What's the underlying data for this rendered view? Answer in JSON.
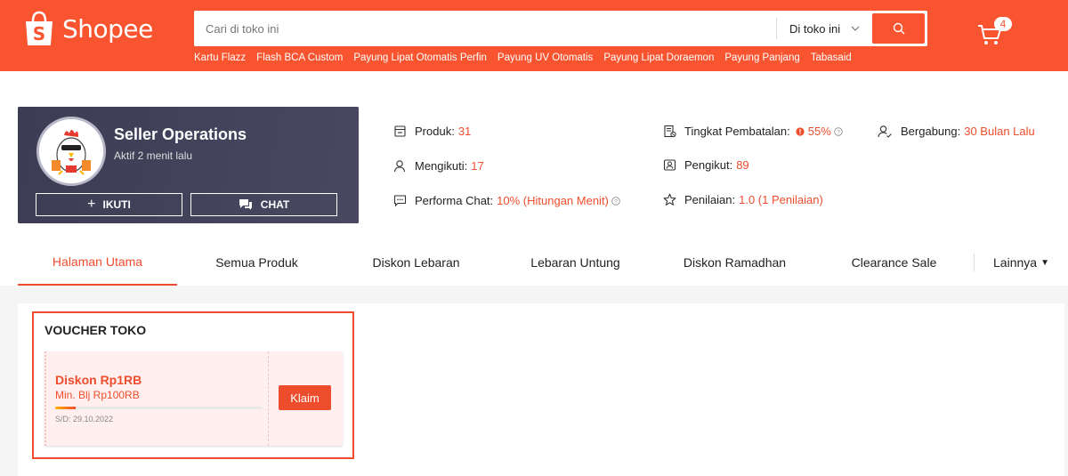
{
  "header": {
    "brand": "Shopee",
    "search_placeholder": "Cari di toko ini",
    "search_scope": "Di toko ini",
    "quick_links": [
      "Kartu Flazz",
      "Flash BCA Custom",
      "Payung Lipat Otomatis Perfin",
      "Payung UV Otomatis",
      "Payung Lipat Doraemon",
      "Payung Panjang",
      "Tabasaid"
    ],
    "cart_count": "4",
    "icons": {
      "search": "search-icon",
      "cart": "cart-icon",
      "scope_dropdown": "chevron-down-icon"
    }
  },
  "shop": {
    "name": "Seller Operations",
    "status": "Aktif 2 menit lalu",
    "follow_label": "IKUTI",
    "chat_label": "CHAT"
  },
  "stats": {
    "produk": {
      "label": "Produk:",
      "value": "31"
    },
    "mengikuti": {
      "label": "Mengikuti:",
      "value": "17"
    },
    "performa_chat": {
      "label": "Performa Chat:",
      "value": "10% (Hitungan Menit)"
    },
    "tingkat_pembatalan": {
      "label": "Tingkat Pembatalan:",
      "value": "55%"
    },
    "pengikut": {
      "label": "Pengikut:",
      "value": "89"
    },
    "penilaian": {
      "label": "Penilaian:",
      "value": "1.0 (1 Penilaian)"
    },
    "bergabung": {
      "label": "Bergabung:",
      "value": "30 Bulan Lalu"
    }
  },
  "tabs": [
    {
      "label": "Halaman Utama",
      "active": true
    },
    {
      "label": "Semua Produk",
      "active": false
    },
    {
      "label": "Diskon Lebaran",
      "active": false
    },
    {
      "label": "Lebaran Untung",
      "active": false
    },
    {
      "label": "Diskon Ramadhan",
      "active": false
    },
    {
      "label": "Clearance Sale",
      "active": false
    },
    {
      "label": "Lainnya",
      "active": false
    }
  ],
  "voucher_section": {
    "title": "VOUCHER TOKO",
    "voucher": {
      "title": "Diskon Rp1RB",
      "min_purchase": "Min. Blj Rp100RB",
      "usage_fraction": 0.1,
      "valid_until": "S/D: 29.10.2022",
      "claim_label": "Klaim"
    }
  },
  "colors": {
    "brand": "#f8542f",
    "accent": "#ee4d2d",
    "card_bg": "#3e3e55"
  }
}
